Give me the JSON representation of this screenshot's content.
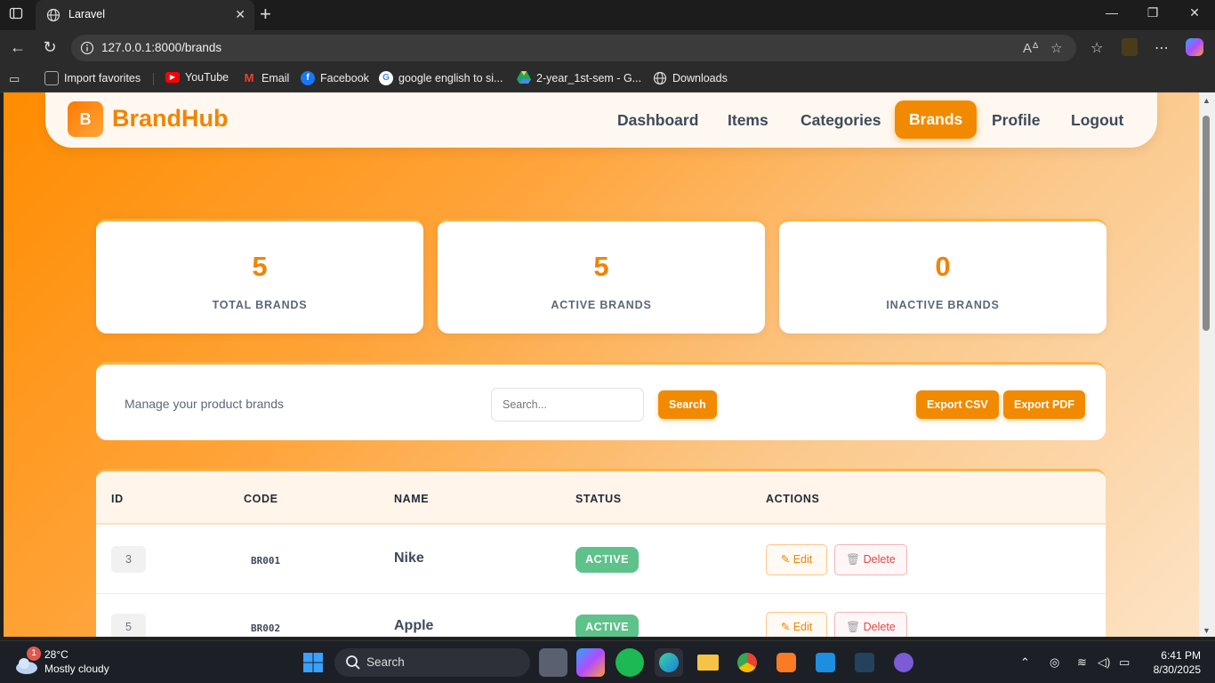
{
  "browser": {
    "tab_title": "Laravel",
    "url": "127.0.0.1:8000/brands",
    "favorites": [
      {
        "label": "Import favorites",
        "icon": "import-icon",
        "color": "#444444"
      },
      {
        "label": "YouTube",
        "icon": "youtube-icon",
        "color": "#ff0000"
      },
      {
        "label": "Email",
        "icon": "gmail-icon",
        "color": "#d93025"
      },
      {
        "label": "Facebook",
        "icon": "facebook-icon",
        "color": "#1877f2"
      },
      {
        "label": "google english to si...",
        "icon": "google-icon",
        "color": "#ffffff"
      },
      {
        "label": "2-year_1st-sem - G...",
        "icon": "drive-icon",
        "color": "#1fa463"
      },
      {
        "label": "Downloads",
        "icon": "globe-icon",
        "color": "#555555"
      }
    ]
  },
  "app": {
    "logo_letter": "B",
    "brand_name": "BrandHub",
    "nav": [
      "Dashboard",
      "Items",
      "Categories",
      "Brands",
      "Profile",
      "Logout"
    ],
    "active_nav": "Brands",
    "accent_color": "#f18a00"
  },
  "stats": [
    {
      "value": "5",
      "label": "TOTAL BRANDS"
    },
    {
      "value": "5",
      "label": "ACTIVE BRANDS"
    },
    {
      "value": "0",
      "label": "INACTIVE BRANDS"
    }
  ],
  "toolbar": {
    "description": "Manage your product brands",
    "search_placeholder": "Search...",
    "search_button": "Search",
    "export_csv": "Export CSV",
    "export_pdf": "Export PDF"
  },
  "table": {
    "headers": [
      "ID",
      "CODE",
      "NAME",
      "STATUS",
      "ACTIONS"
    ],
    "rows": [
      {
        "id": "3",
        "code": "BR001",
        "name": "Nike",
        "status": "ACTIVE",
        "edit": "Edit",
        "delete": "Delete"
      },
      {
        "id": "5",
        "code": "BR002",
        "name": "Apple",
        "status": "ACTIVE",
        "edit": "Edit",
        "delete": "Delete"
      }
    ]
  },
  "taskbar": {
    "weather_badge": "1",
    "temperature": "28°C",
    "condition": "Mostly cloudy",
    "search_label": "Search",
    "time": "6:41 PM",
    "date": "8/30/2025"
  }
}
